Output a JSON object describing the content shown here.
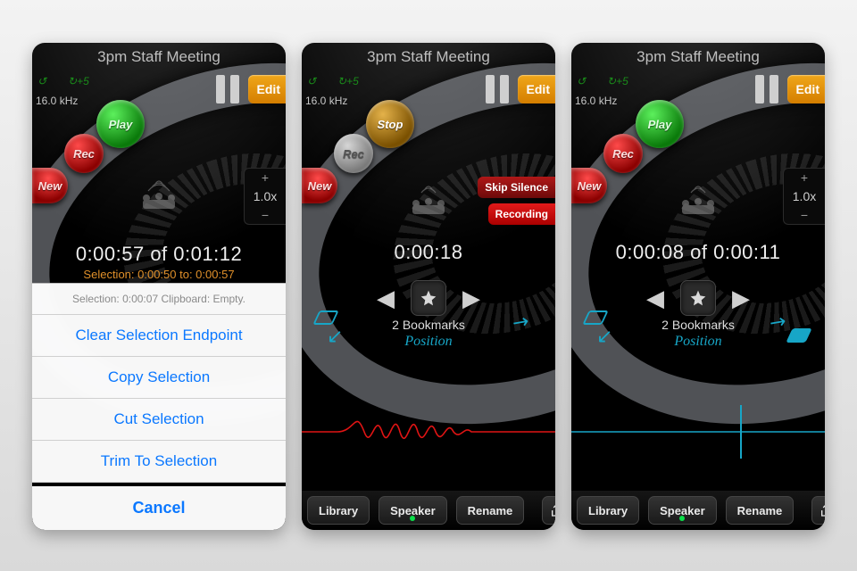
{
  "title": "3pm Staff Meeting",
  "khz": "16.0 kHz",
  "speed": "1.0x",
  "edit": "Edit",
  "spin": "+5",
  "play": "Play",
  "stop": "Stop",
  "rec": "Rec",
  "new": "New",
  "bookmarks": "2 Bookmarks",
  "position": "Position",
  "library": "Library",
  "speaker": "Speaker",
  "rename": "Rename",
  "screen1": {
    "time": "0:00:57 of 0:01:12",
    "selection": "Selection:   0:00:50  to:   0:00:57",
    "sheet": {
      "info": "Selection:  0:00:07   Clipboard: Empty.",
      "opts": [
        "Clear Selection Endpoint",
        "Copy Selection",
        "Cut Selection",
        "Trim To Selection"
      ],
      "cancel": "Cancel"
    }
  },
  "screen2": {
    "time": "0:00:18",
    "skip": "Skip Silence",
    "recording": "Recording"
  },
  "screen3": {
    "time": "0:00:08 of 0:00:11"
  }
}
